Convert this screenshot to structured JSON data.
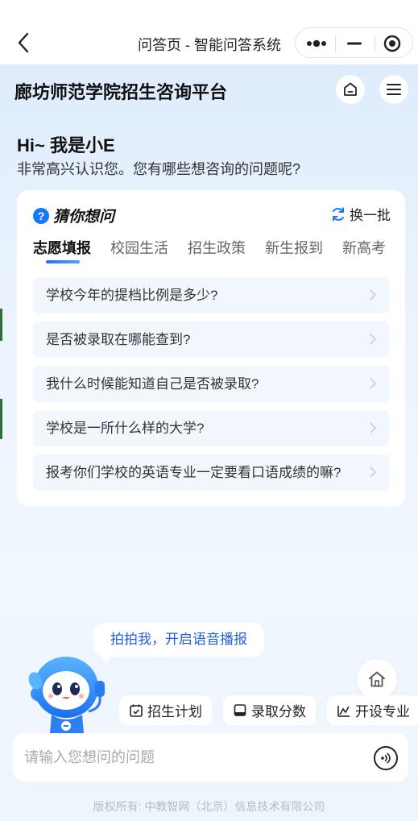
{
  "navbar": {
    "title": "问答页 - 智能问答系统"
  },
  "header": {
    "app_title": "廊坊师范学院招生咨询平台"
  },
  "greeting": {
    "title": "Hi~ 我是小E",
    "subtitle": "非常高兴认识您。您有哪些想咨询的问题呢?"
  },
  "card": {
    "title": "猜你想问",
    "refresh_label": "换一批",
    "tabs": [
      {
        "label": "志愿填报",
        "active": true
      },
      {
        "label": "校园生活",
        "active": false
      },
      {
        "label": "招生政策",
        "active": false
      },
      {
        "label": "新生报到",
        "active": false
      },
      {
        "label": "新高考",
        "active": false
      }
    ],
    "questions": [
      "学校今年的提档比例是多少?",
      "是否被录取在哪能查到?",
      "我什么时候能知道自己是否被录取?",
      "学校是一所什么样的大学?",
      "报考你们学校的英语专业一定要看口语成绩的嘛?"
    ]
  },
  "assistant": {
    "bubble_text": "拍拍我，开启语音播报"
  },
  "quick_chips": [
    {
      "label": "招生计划",
      "icon": "calendar-check-icon"
    },
    {
      "label": "录取分数",
      "icon": "book-icon"
    },
    {
      "label": "开设专业",
      "icon": "chart-icon"
    }
  ],
  "input": {
    "placeholder": "请输入您想问的问题"
  },
  "footer": {
    "copyright": "版权所有: 中教智网（北京）信息技术有限公司"
  },
  "colors": {
    "accent": "#1677ff",
    "bubble_text": "#2660d6",
    "question_bg": "#f2f7fe"
  }
}
